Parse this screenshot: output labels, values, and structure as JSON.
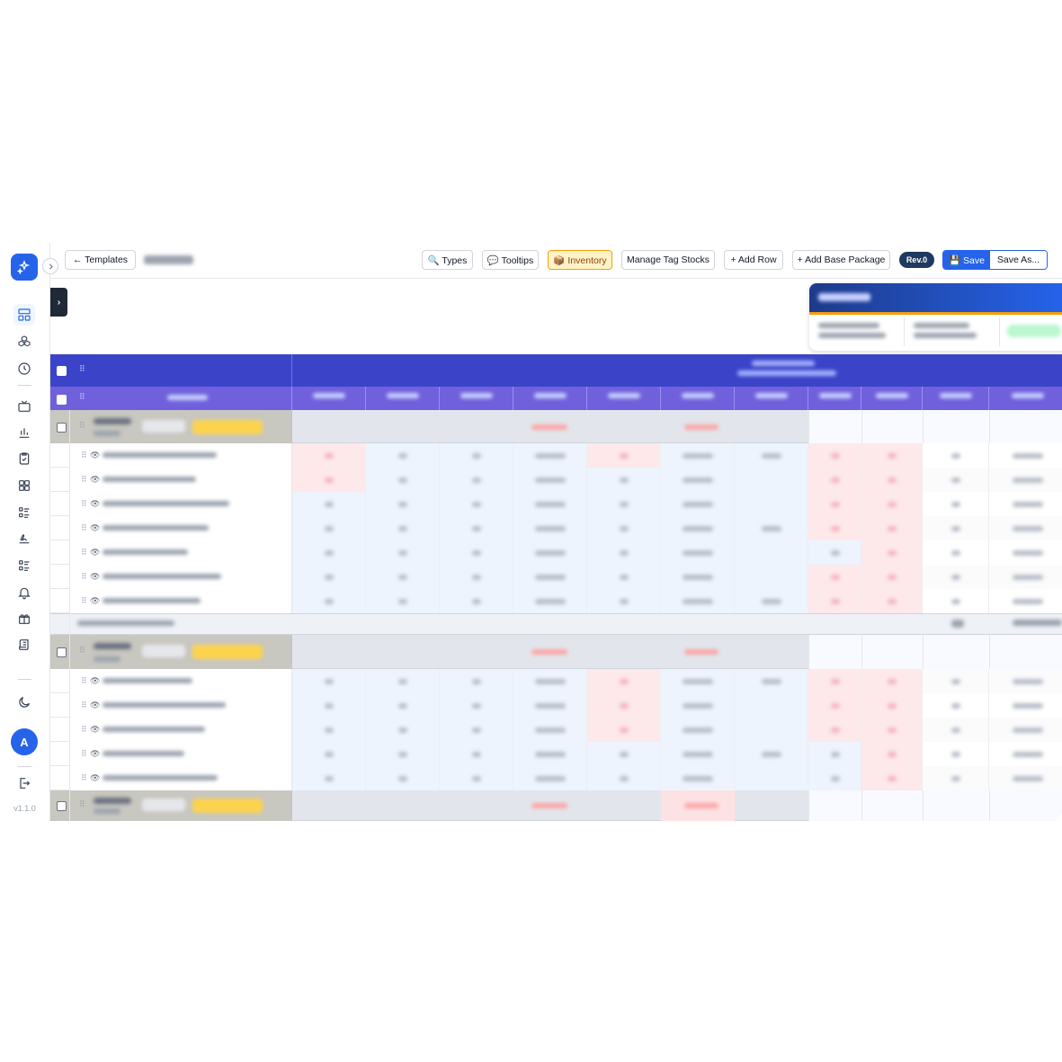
{
  "toolbar": {
    "back_label": "← Templates",
    "types_label": "🔍 Types",
    "tooltips_label": "💬 Tooltips",
    "inventory_label": "📦 Inventory",
    "manage_tag_stocks_label": "Manage Tag Stocks",
    "add_row_label": "+ Add Row",
    "add_base_package_label": "+ Add Base Package",
    "revision_label": "Rev.0",
    "save_label": "💾 Save",
    "save_as_label": "Save As..."
  },
  "sidebar": {
    "version": "v1.1.0",
    "avatar_initial": "A",
    "items": [
      {
        "icon": "dashboard-icon",
        "active": true
      },
      {
        "icon": "cubes-icon"
      },
      {
        "icon": "clock-icon"
      },
      {
        "icon": "tv-icon"
      },
      {
        "icon": "bar-chart-icon"
      },
      {
        "icon": "clipboard-check-icon"
      },
      {
        "icon": "grid-icon"
      },
      {
        "icon": "list-icon"
      },
      {
        "icon": "signature-icon"
      },
      {
        "icon": "checklist-icon"
      },
      {
        "icon": "bell-icon"
      },
      {
        "icon": "gift-icon"
      },
      {
        "icon": "scroll-icon"
      },
      {
        "icon": "moon-icon"
      },
      {
        "icon": "logout-icon"
      }
    ]
  },
  "drawer_toggle": "›",
  "colors": {
    "header_dark": "#3b44c8",
    "header_light": "#7160dc",
    "group_row": "#c8c7c0",
    "pale_blue": "#eef4fd",
    "pale_red": "#fde8ea",
    "accent": "#2563eb"
  }
}
